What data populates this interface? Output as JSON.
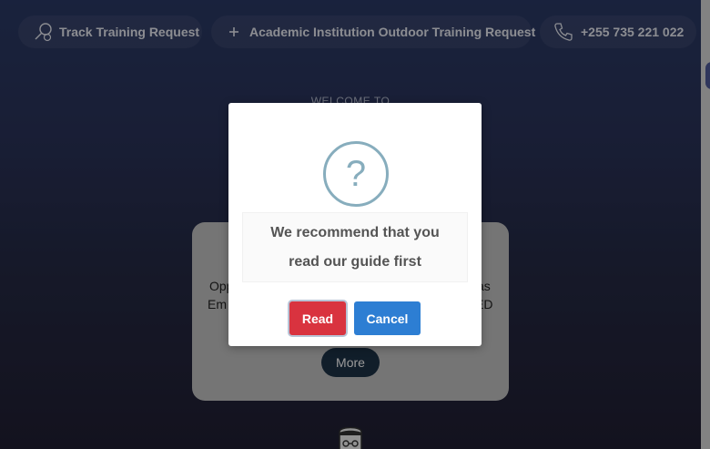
{
  "topbar": {
    "track_label": "Track Training Request",
    "academic_label": "Academic Institution Outdoor Training Request",
    "phone_label": "+255 735 221 022"
  },
  "hero": {
    "welcome": "WELCOME TO"
  },
  "card": {
    "line1_left": "Opp",
    "line1_right": "as",
    "line2_left": "Em",
    "line2_right": "ED",
    "more_label": "More"
  },
  "dialog": {
    "icon_glyph": "?",
    "message": "We recommend that you read our guide first",
    "read_label": "Read",
    "cancel_label": "Cancel"
  },
  "colors": {
    "read_button": "#d9333f",
    "cancel_button": "#2d7ed3",
    "question_icon": "#87adbd"
  },
  "icons": [
    "search-person-icon",
    "plus-icon",
    "phone-icon",
    "question-icon",
    "avatar-icon"
  ]
}
